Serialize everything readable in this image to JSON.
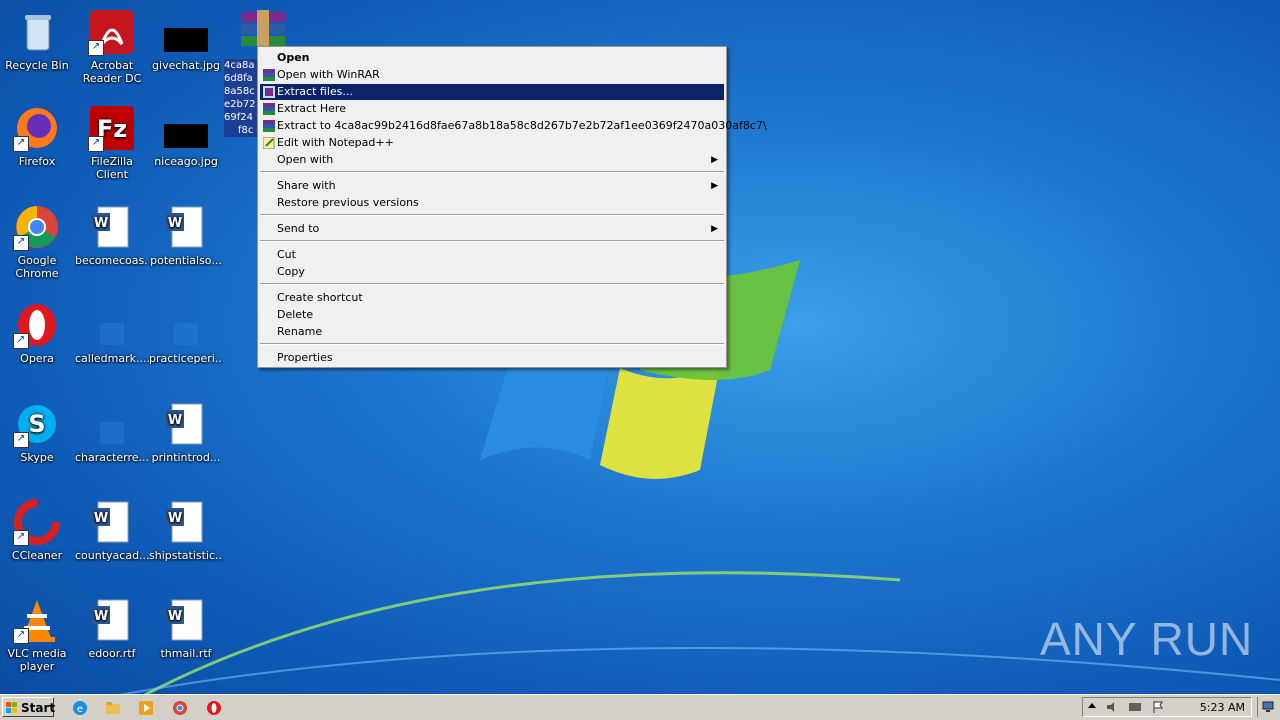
{
  "desktop": {
    "icons": [
      {
        "label": "Recycle Bin"
      },
      {
        "label": "Acrobat Reader DC"
      },
      {
        "label": "givechat.jpg"
      },
      {
        "label": "Firefox"
      },
      {
        "label": "FileZilla Client"
      },
      {
        "label": "niceago.jpg"
      },
      {
        "label": "Google Chrome"
      },
      {
        "label": "becomecoas..."
      },
      {
        "label": "potentialso..."
      },
      {
        "label": "Opera"
      },
      {
        "label": "calledmark...."
      },
      {
        "label": "practiceperi..."
      },
      {
        "label": "Skype"
      },
      {
        "label": "characterre..."
      },
      {
        "label": "printintrod..."
      },
      {
        "label": "CCleaner"
      },
      {
        "label": "countyacad..."
      },
      {
        "label": "shipstatistic..."
      },
      {
        "label": "VLC media player"
      },
      {
        "label": "edoor.rtf"
      },
      {
        "label": "thmail.rtf"
      }
    ],
    "selected_file_label_lines": [
      "4ca8a",
      "6d8fa",
      "8a58c",
      "e2b72",
      "69f24",
      "f8c"
    ]
  },
  "context_menu": {
    "items": [
      {
        "label": "Open"
      },
      {
        "label": "Open with WinRAR"
      },
      {
        "label": "Extract files..."
      },
      {
        "label": "Extract Here"
      },
      {
        "label": "Extract to 4ca8ac99b2416d8fae67a8b18a58c8d267b7e2b72af1ee0369f2470a030af8c7\\"
      },
      {
        "label": "Edit with Notepad++"
      },
      {
        "label": "Open with"
      },
      {
        "label": "Share with"
      },
      {
        "label": "Restore previous versions"
      },
      {
        "label": "Send to"
      },
      {
        "label": "Cut"
      },
      {
        "label": "Copy"
      },
      {
        "label": "Create shortcut"
      },
      {
        "label": "Delete"
      },
      {
        "label": "Rename"
      },
      {
        "label": "Properties"
      }
    ],
    "submenu_arrow": "▶"
  },
  "taskbar": {
    "start_label": "Start",
    "clock": "5:23 AM"
  },
  "watermark": "ANY  RUN",
  "colors": {
    "menu_highlight": "#0a246a",
    "desktop_blue": "#1e78d0"
  }
}
